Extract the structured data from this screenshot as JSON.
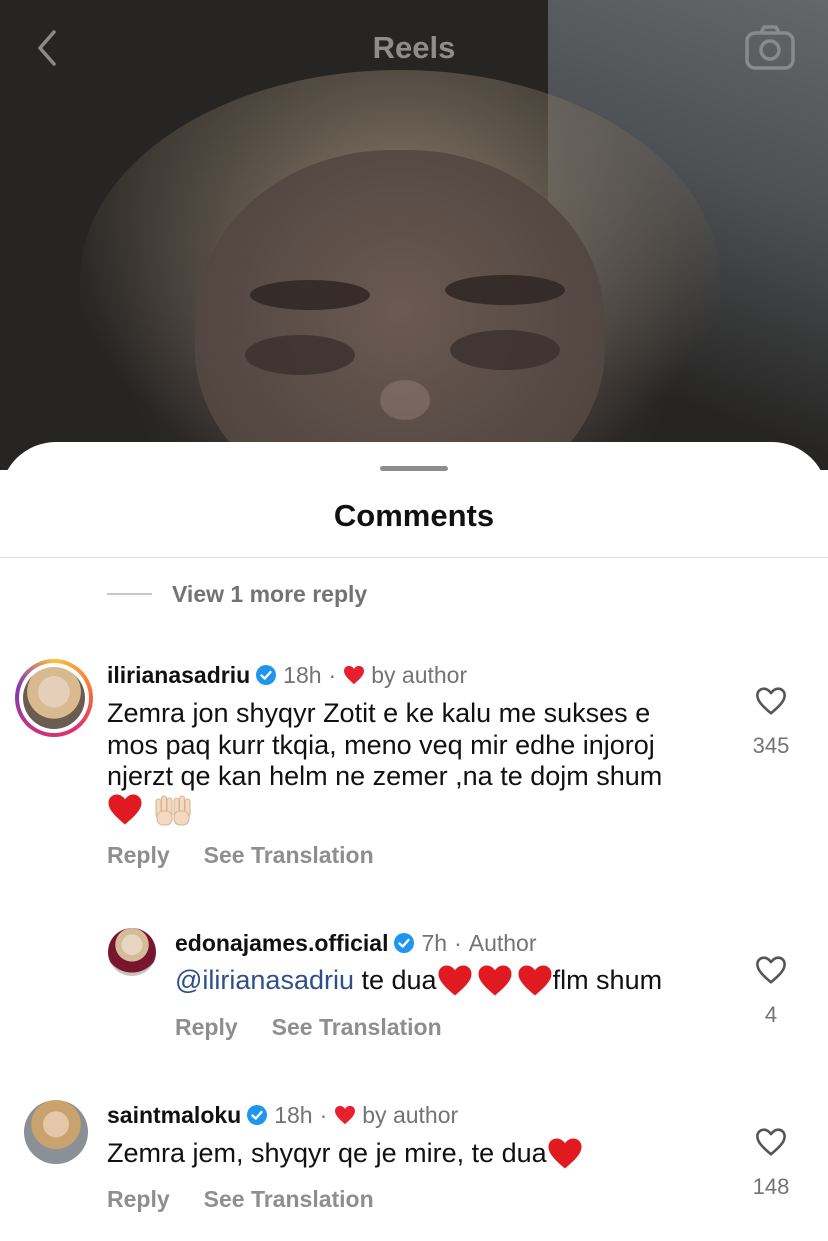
{
  "header": {
    "title": "Reels"
  },
  "sheet": {
    "title": "Comments"
  },
  "view_more": "View 1 more reply",
  "comments": [
    {
      "username": "ilirianasadriu",
      "time": "18h",
      "dot": "·",
      "liked_by": "by author",
      "text_line1": "Zemra jon shyqyr Zotit e ke kalu me sukses e",
      "text_line2": "mos paq kurr tkqia, meno veq mir edhe injoroj",
      "text_line3": "njerzt qe kan helm ne zemer ,na te dojm shum",
      "likes": "345",
      "reply": "Reply",
      "translate": "See Translation"
    },
    {
      "username": "edonajames.official",
      "time": "7h",
      "dot": "·",
      "role": "Author",
      "mention": "@ilirianasadriu",
      "text_a": " te dua",
      "text_b": "flm shum",
      "likes": "4",
      "reply": "Reply",
      "translate": "See Translation"
    },
    {
      "username": "saintmaloku",
      "time": "18h",
      "dot": "·",
      "liked_by": "by author",
      "text": "Zemra jem, shyqyr qe je mire, te dua",
      "likes": "148",
      "reply": "Reply",
      "translate": "See Translation"
    }
  ],
  "colors": {
    "heart": "#e8202d",
    "verified": "#1e96f0",
    "muted": "#737373"
  }
}
